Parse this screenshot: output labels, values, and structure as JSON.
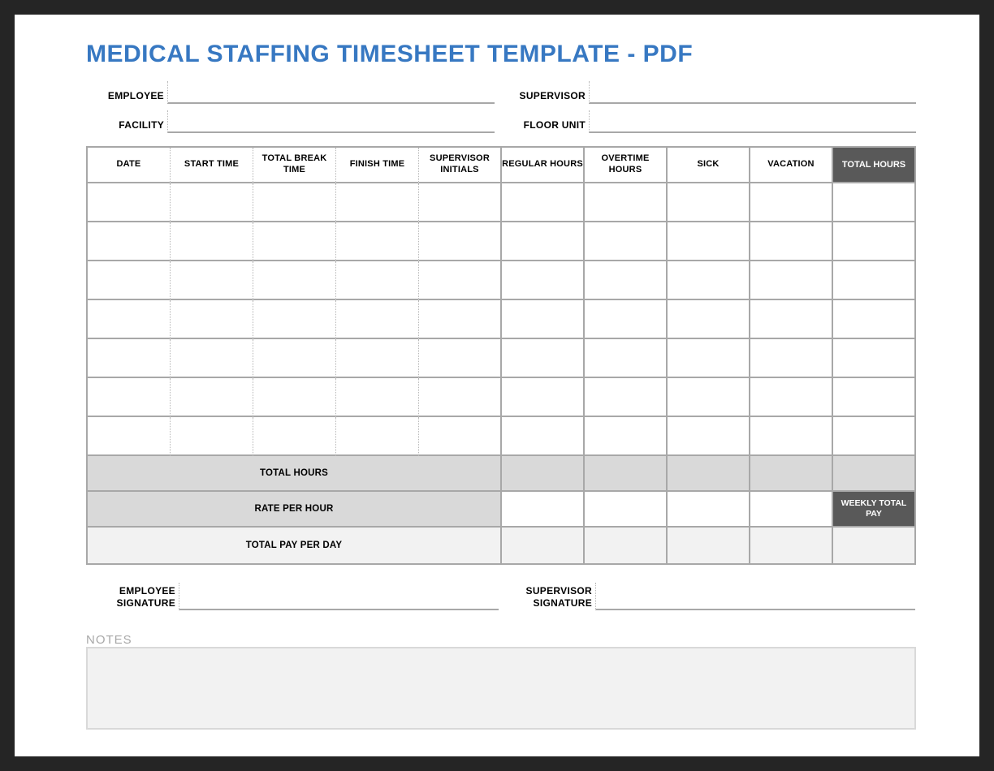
{
  "title": "MEDICAL STAFFING TIMESHEET TEMPLATE - PDF",
  "info": {
    "employee_label": "EMPLOYEE",
    "supervisor_label": "SUPERVISOR",
    "facility_label": "FACILITY",
    "floor_unit_label": "FLOOR UNIT",
    "employee_value": "",
    "supervisor_value": "",
    "facility_value": "",
    "floor_unit_value": ""
  },
  "columns": {
    "date": "DATE",
    "start_time": "START TIME",
    "total_break_time": "TOTAL BREAK TIME",
    "finish_time": "FINISH TIME",
    "supervisor_initials": "SUPERVISOR INITIALS",
    "regular_hours": "REGULAR HOURS",
    "overtime_hours": "OVERTIME HOURS",
    "sick": "SICK",
    "vacation": "VACATION",
    "total_hours": "TOTAL HOURS"
  },
  "summary": {
    "total_hours_label": "TOTAL HOURS",
    "rate_per_hour_label": "RATE PER HOUR",
    "total_pay_per_day_label": "TOTAL PAY PER DAY",
    "weekly_total_pay_label": "WEEKLY TOTAL PAY"
  },
  "signature": {
    "employee_signature_label": "EMPLOYEE SIGNATURE",
    "supervisor_signature_label": "SUPERVISOR SIGNATURE"
  },
  "notes": {
    "label": "NOTES",
    "value": ""
  }
}
